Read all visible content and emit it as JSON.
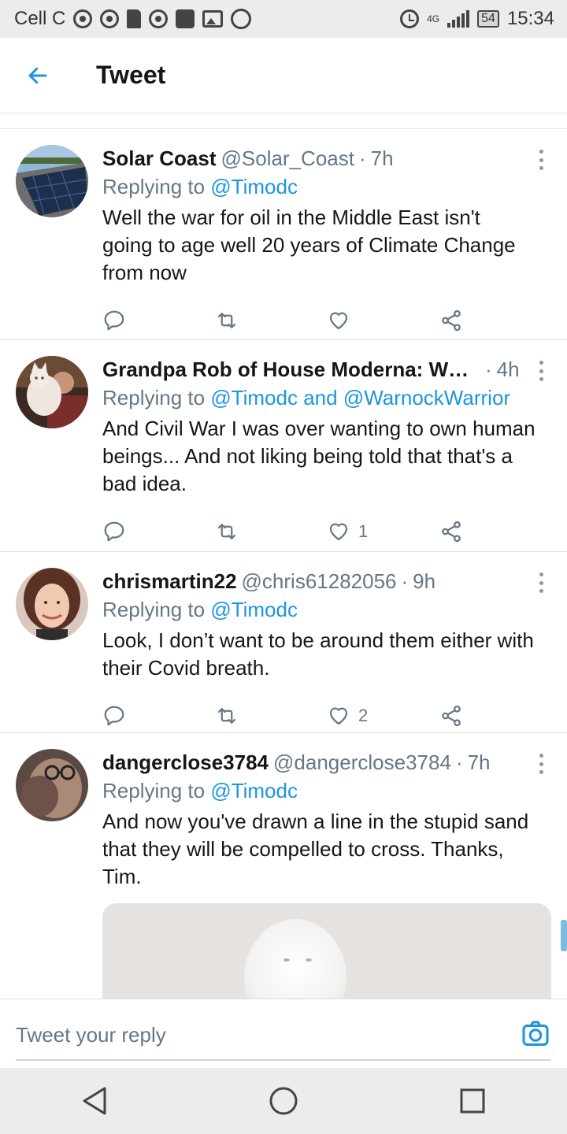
{
  "status_bar": {
    "carrier": "Cell C",
    "network": "4G",
    "battery": "54",
    "time": "15:34"
  },
  "header": {
    "title": "Tweet"
  },
  "tweets": [
    {
      "name": "Solar Coast",
      "handle": "@Solar_Coast",
      "time": "7h",
      "replying_prefix": "Replying to",
      "mentions": "@Timodc",
      "text": "Well the war for oil in the Middle East isn't going to age well 20 years of Climate Change from now",
      "likes": "",
      "avatar": "solar-panel-photo"
    },
    {
      "name": "Grandpa Rob of House Moderna: WEA...",
      "handle": "",
      "time": "4h",
      "replying_prefix": "Replying to",
      "mentions": "@Timodc and @WarnockWarrior",
      "text": "And Civil War I was over wanting to own human beings... And not liking being told that that's a bad idea.",
      "likes": "1",
      "avatar": "man-with-cat-photo"
    },
    {
      "name": "chrismartin22",
      "handle": "@chris61282056",
      "time": "9h",
      "replying_prefix": "Replying to",
      "mentions": "@Timodc",
      "text": "Look, I don’t want to be around them either with their Covid breath.",
      "likes": "2",
      "avatar": "woman-portrait-photo"
    },
    {
      "name": "dangerclose3784",
      "handle": "@dangerclose3784",
      "time": "7h",
      "replying_prefix": "Replying to",
      "mentions": "@Timodc",
      "text": "And now you've drawn a line in the stupid sand that they will be compelled to cross. Thanks, Tim.",
      "likes": "",
      "avatar": "person-with-glasses-photo"
    }
  ],
  "reply_bar": {
    "placeholder": "Tweet your reply"
  },
  "colors": {
    "accent": "#1b95e0",
    "secondary_text": "#657786",
    "divider": "#e1e8ed"
  }
}
